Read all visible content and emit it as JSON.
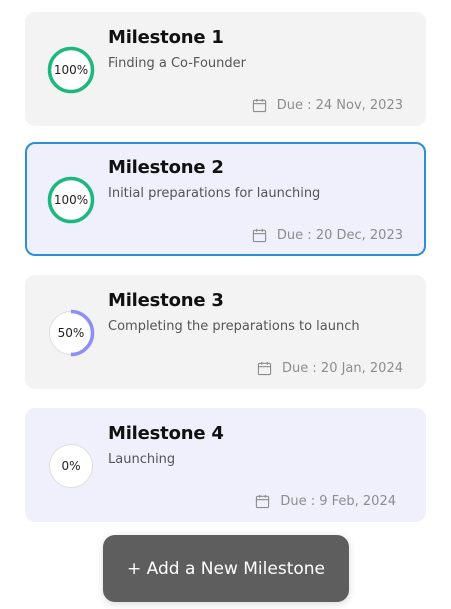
{
  "colors": {
    "card_bg": "#f3f3f3",
    "card_tint_bg": "#eff0fc",
    "selected_border": "#2b8fd8",
    "complete_ring": "#1eb87e",
    "partial_ring": "#8e8ff5",
    "track": "#dedede",
    "add_button_bg": "#5e5e5e"
  },
  "milestones": [
    {
      "title": "Milestone 1",
      "description": "Finding a Co-Founder",
      "progress_label": "100%",
      "progress": 1.0,
      "due": "Due : 24 Nov, 2023",
      "icon": "calendar-icon"
    },
    {
      "title": "Milestone 2",
      "description": "Initial preparations for launching",
      "progress_label": "100%",
      "progress": 1.0,
      "due": "Due : 20 Dec, 2023",
      "icon": "calendar-icon",
      "selected": true
    },
    {
      "title": "Milestone 3",
      "description": "Completing the preparations to launch",
      "progress_label": "50%",
      "progress": 0.5,
      "due": "Due : 20 Jan, 2024",
      "icon": "calendar-icon"
    },
    {
      "title": "Milestone 4",
      "description": "Launching",
      "progress_label": "0%",
      "progress": 0.0,
      "due": "Due : 9 Feb, 2024",
      "icon": "calendar-icon"
    }
  ],
  "add_button": {
    "label": "+ Add a New Milestone"
  }
}
